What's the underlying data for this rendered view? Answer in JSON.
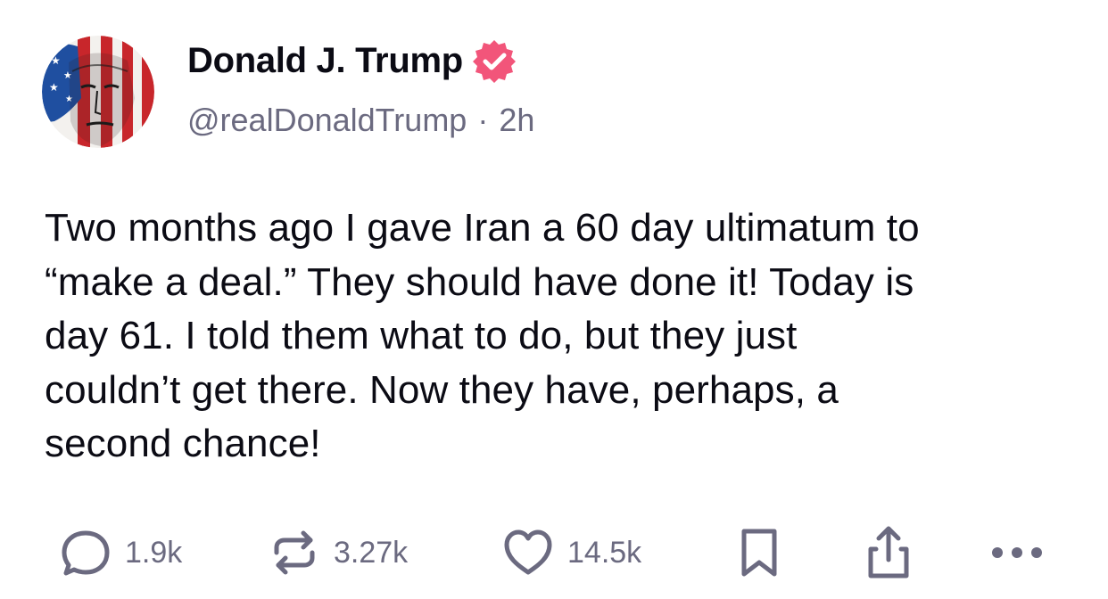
{
  "author": {
    "display_name": "Donald J. Trump",
    "handle": "@realDonaldTrump",
    "separator": "·",
    "time_ago": "2h",
    "verified_color": "#f2557a"
  },
  "post": {
    "lines": [
      "Two months ago I gave Iran a 60 day ultimatum to",
      "“make a deal.” They should have done it! Today is",
      "day 61. I told them what to do, but they just",
      "couldn’t get there. Now they have, perhaps, a",
      "second chance!"
    ]
  },
  "actions": {
    "replies": "1.9k",
    "reposts": "3.27k",
    "likes": "14.5k",
    "icons": [
      "reply-icon",
      "repost-icon",
      "heart-icon",
      "bookmark-icon",
      "share-icon",
      "more-icon"
    ],
    "icon_color": "#6b6a80"
  }
}
